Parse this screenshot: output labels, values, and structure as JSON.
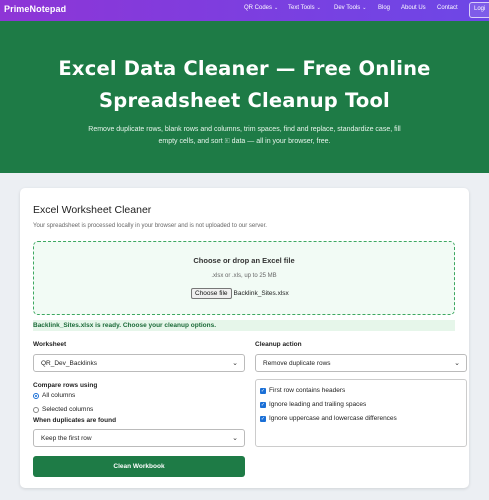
{
  "nav": {
    "brand": "PrimeNotepad",
    "items": [
      {
        "label": "QR Codes",
        "chevron": "⌄"
      },
      {
        "label": "Text Tools",
        "chevron": "⌄"
      },
      {
        "label": "Dev Tools",
        "chevron": "⌄"
      },
      {
        "label": "Blog",
        "chevron": ""
      },
      {
        "label": "About Us",
        "chevron": ""
      },
      {
        "label": "Contact",
        "chevron": ""
      }
    ],
    "login": "Logi"
  },
  "hero": {
    "title": "Excel Data Cleaner — Free Online Spreadsheet Cleanup Tool",
    "subtitle": "Remove duplicate rows, blank rows and columns, trim spaces, find and replace, standardize case, fill empty cells, and sort 🗉 data — all in your browser, free."
  },
  "tool": {
    "title": "Excel Worksheet Cleaner",
    "privacy_note": "Your spreadsheet is processed locally in your browser and is not uploaded to our server.",
    "dropzone": {
      "title": "Choose or drop an Excel file",
      "hint": ".xlsx or .xls, up to 25 MB",
      "choose_label": "Choose file",
      "file_name": "Backlink_Sites.xlsx"
    },
    "status": "Backlink_Sites.xlsx is ready. Choose your cleanup options.",
    "worksheet": {
      "label": "Worksheet",
      "value": "QR_Dev_Backlinks"
    },
    "action": {
      "label": "Cleanup action",
      "value": "Remove duplicate rows"
    },
    "compare": {
      "label": "Compare rows using",
      "options": [
        {
          "label": "All columns",
          "selected": true
        },
        {
          "label": "Selected columns",
          "selected": false
        }
      ]
    },
    "duplicates": {
      "label": "When duplicates are found",
      "value": "Keep the first row"
    },
    "checks": [
      {
        "label": "First row contains headers",
        "checked": true
      },
      {
        "label": "Ignore leading and trailing spaces",
        "checked": true
      },
      {
        "label": "Ignore uppercase and lowercase differences",
        "checked": true
      }
    ],
    "submit": "Clean Workbook"
  },
  "colors": {
    "nav_gradient_start": "#8e35d6",
    "hero_green": "#1e7b46",
    "accent_blue": "#1a6fd6"
  }
}
